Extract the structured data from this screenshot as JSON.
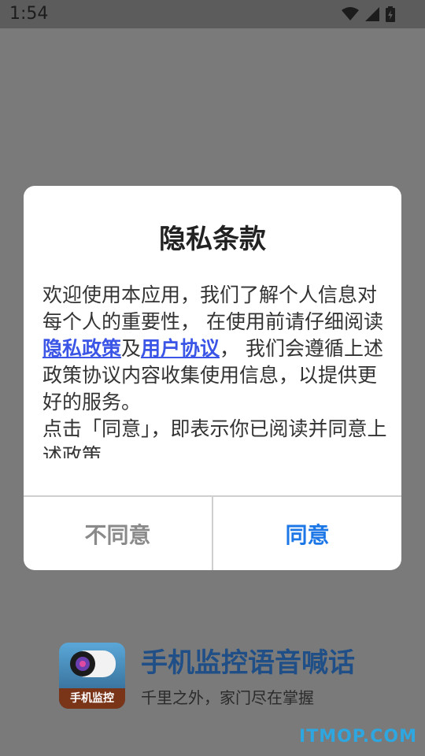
{
  "status": {
    "time": "1:54"
  },
  "dialog": {
    "title": "隐私条款",
    "body": {
      "p1_a": "欢迎使用本应用，我们了解个人信息对每个人的重要性， 在使用前请仔细阅读",
      "link_privacy": "隐私政策",
      "and": "及",
      "link_terms": "用户协议",
      "p1_b": "， 我们会遵循上述政策协议内容收集使用信息，以提供更好的服务。",
      "p2": "点击「同意」，即表示你已阅读并同意上述政策"
    },
    "buttons": {
      "disagree": "不同意",
      "agree": "同意"
    }
  },
  "brand": {
    "app_icon_label": "手机监控",
    "title": "手机监控语音喊话",
    "subtitle": "千里之外，家门尽在掌握"
  },
  "watermark": "ITMOP.COM",
  "colors": {
    "link": "#3b55e6",
    "agree": "#1e77e6",
    "brand": "#1f4f86"
  }
}
